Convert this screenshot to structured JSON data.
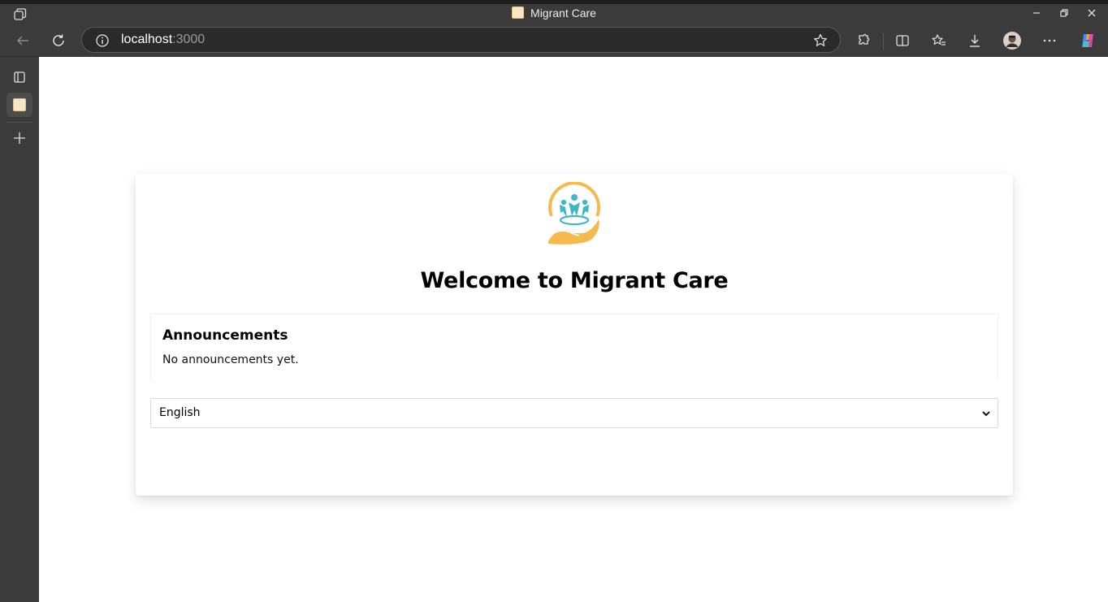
{
  "window": {
    "title": "Migrant Care"
  },
  "browser": {
    "url_host": "localhost",
    "url_port": ":3000"
  },
  "page": {
    "heading": "Welcome to Migrant Care",
    "announcements": {
      "title": "Announcements",
      "empty_text": "No announcements yet."
    },
    "language_select": {
      "selected": "English"
    }
  },
  "colors": {
    "logo_orange": "#f6b94e",
    "logo_teal": "#3fb7c6",
    "chrome_bg": "#3b3b3b"
  }
}
